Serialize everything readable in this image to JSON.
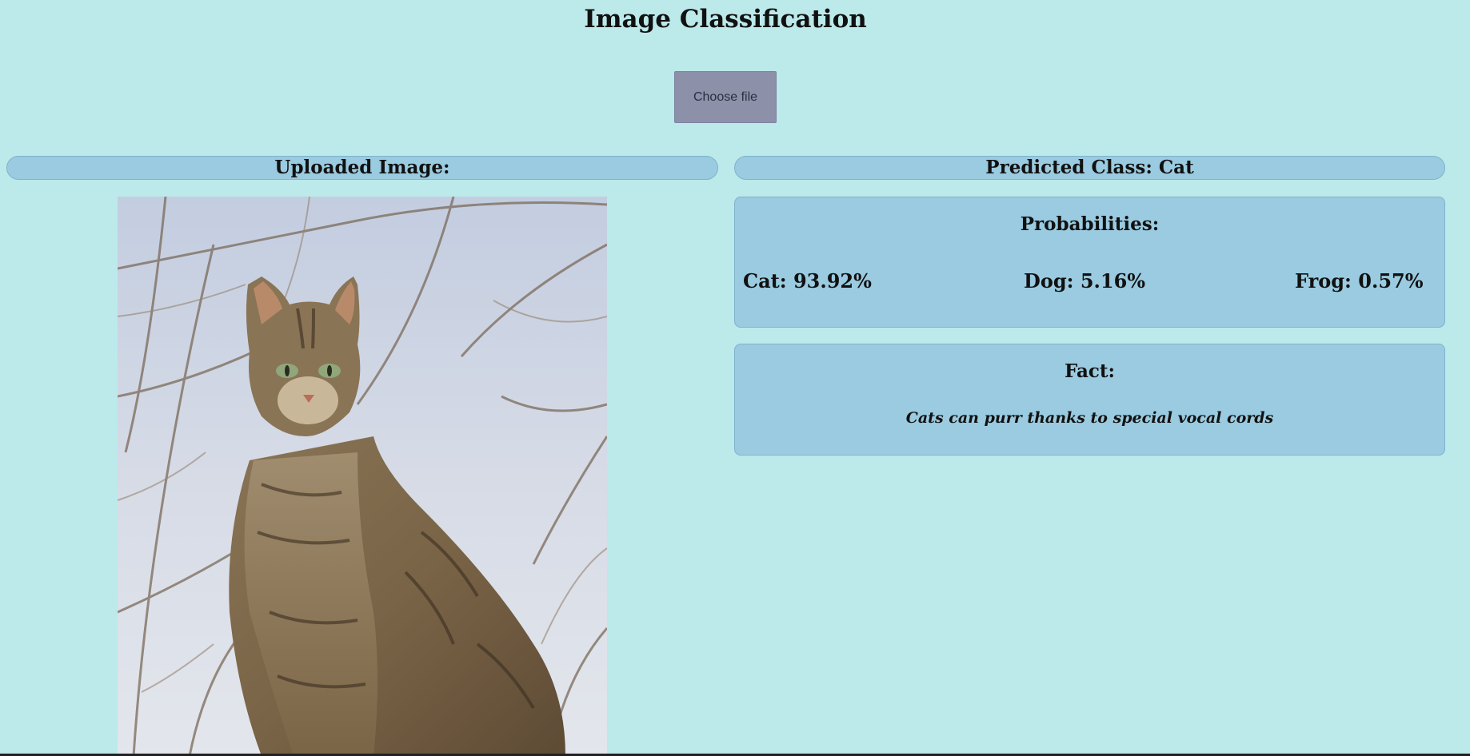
{
  "header": {
    "title": "Image Classification"
  },
  "upload": {
    "button_label": "Choose file"
  },
  "left_panel": {
    "heading": "Uploaded Image:",
    "image_subject": "tabby cat sitting in front of bare branches"
  },
  "right_panel": {
    "predicted_heading": "Predicted Class: Cat",
    "probabilities": {
      "heading": "Probabilities:",
      "items": [
        {
          "label": "Cat: 93.92%",
          "class": "Cat",
          "value": 93.92
        },
        {
          "label": "Dog: 5.16%",
          "class": "Dog",
          "value": 5.16
        },
        {
          "label": "Frog: 0.57%",
          "class": "Frog",
          "value": 0.57
        }
      ]
    },
    "fact": {
      "heading": "Fact:",
      "text": "Cats can purr thanks to special vocal cords"
    }
  },
  "colors": {
    "background": "#bce9ea",
    "panel": "#9acbe0",
    "panel_border": "#7fb3cc",
    "button": "#8c90a8"
  }
}
